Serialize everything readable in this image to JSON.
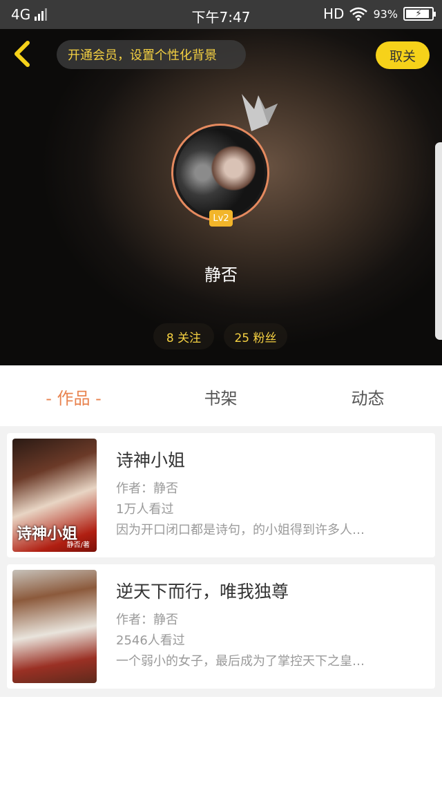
{
  "status_bar": {
    "network": "4G",
    "time": "下午7:47",
    "hd": "HD",
    "battery": "93%"
  },
  "header": {
    "vip_banner": "开通会员，设置个性化背景",
    "follow_button": "取关",
    "level": "Lv2",
    "username": "静否",
    "following": "8 关注",
    "fans": "25 粉丝"
  },
  "tabs": [
    {
      "label": "- 作品 -",
      "active": true
    },
    {
      "label": "书架",
      "active": false
    },
    {
      "label": "动态",
      "active": false
    }
  ],
  "books": [
    {
      "title": "诗神小姐",
      "author": "作者：静否",
      "views": "1万人看过",
      "summary": "因为开口闭口都是诗句，的小姐得到许多人…",
      "cover_title": "诗神小姐",
      "cover_author": "静否/著"
    },
    {
      "title": "逆天下而行，唯我独尊",
      "author": "作者：静否",
      "views": "2546人看过",
      "summary": "一个弱小的女子，最后成为了掌控天下之皇…"
    }
  ],
  "colors": {
    "accent": "#e8834f",
    "follow_button": "#f6d21a",
    "vip_text": "#f5d142"
  }
}
